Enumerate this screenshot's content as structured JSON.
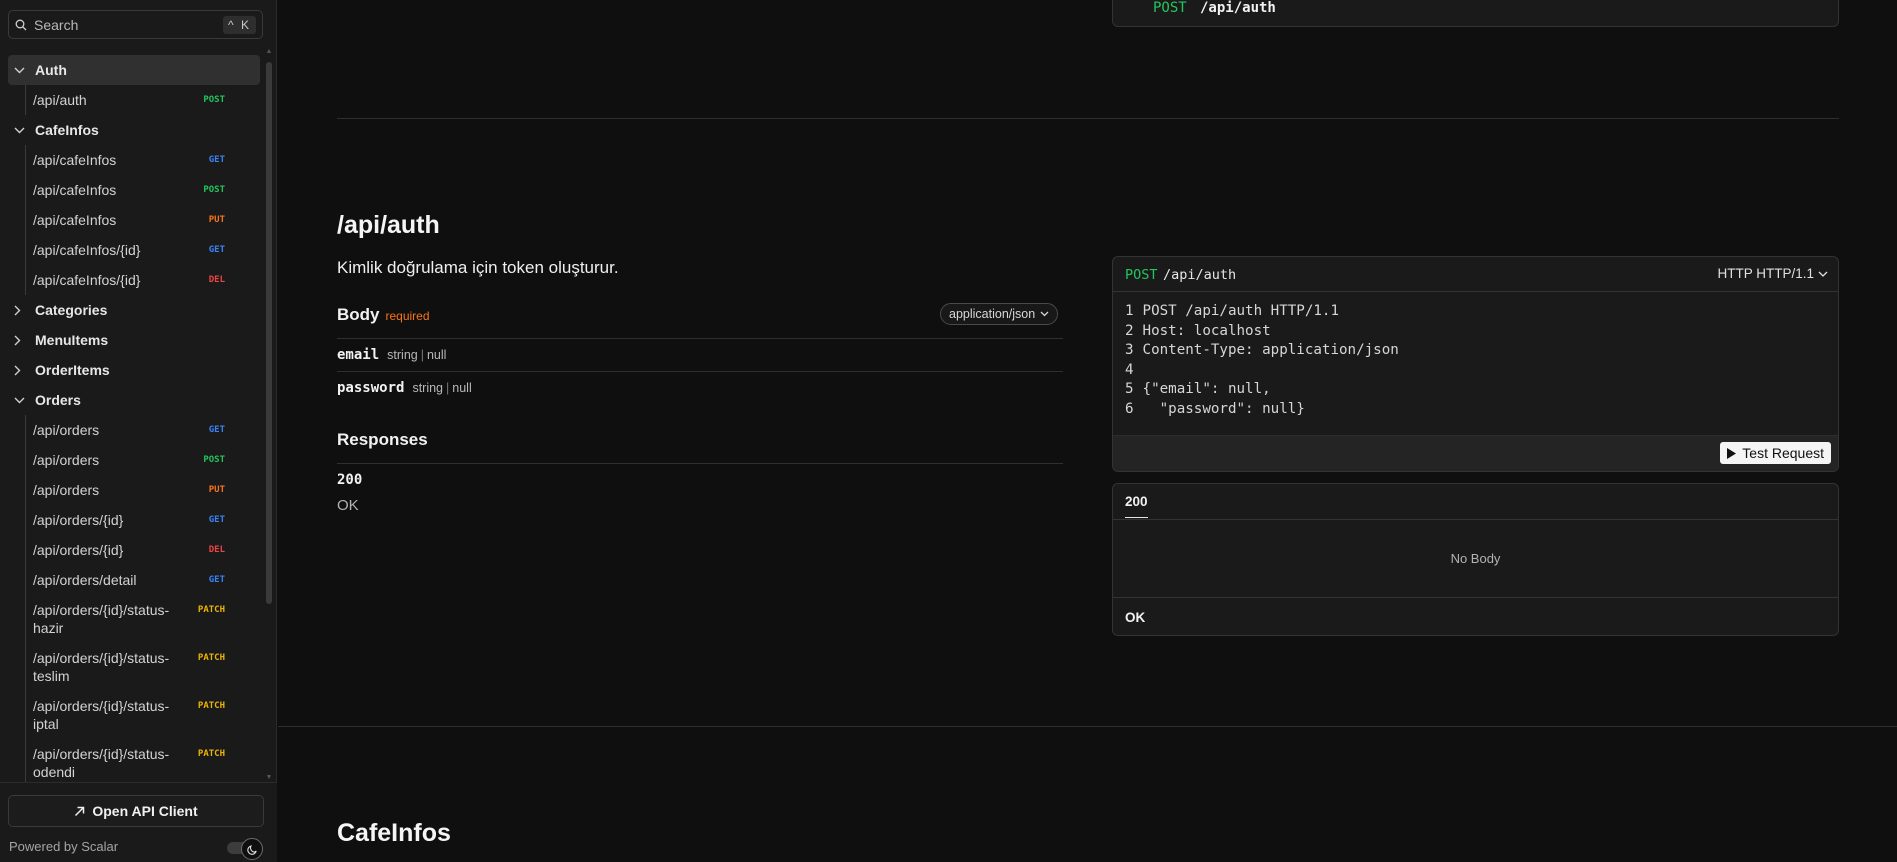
{
  "search": {
    "placeholder": "Search",
    "shortcut": "^ K"
  },
  "sidebar": {
    "groups": [
      {
        "label": "Auth",
        "expanded": true,
        "active": true,
        "items": [
          {
            "path": "/api/auth",
            "method": "POST"
          }
        ]
      },
      {
        "label": "CafeInfos",
        "expanded": true,
        "items": [
          {
            "path": "/api/cafeInfos",
            "method": "GET"
          },
          {
            "path": "/api/cafeInfos",
            "method": "POST"
          },
          {
            "path": "/api/cafeInfos",
            "method": "PUT"
          },
          {
            "path": "/api/cafeInfos/{id}",
            "method": "GET"
          },
          {
            "path": "/api/cafeInfos/{id}",
            "method": "DEL"
          }
        ]
      },
      {
        "label": "Categories",
        "expanded": false,
        "items": []
      },
      {
        "label": "MenuItems",
        "expanded": false,
        "items": []
      },
      {
        "label": "OrderItems",
        "expanded": false,
        "items": []
      },
      {
        "label": "Orders",
        "expanded": true,
        "items": [
          {
            "path": "/api/orders",
            "method": "GET"
          },
          {
            "path": "/api/orders",
            "method": "POST"
          },
          {
            "path": "/api/orders",
            "method": "PUT"
          },
          {
            "path": "/api/orders/{id}",
            "method": "GET"
          },
          {
            "path": "/api/orders/{id}",
            "method": "DEL"
          },
          {
            "path": "/api/orders/detail",
            "method": "GET"
          },
          {
            "path": "/api/orders/{id}/status-hazir",
            "method": "PATCH"
          },
          {
            "path": "/api/orders/{id}/status-teslim",
            "method": "PATCH"
          },
          {
            "path": "/api/orders/{id}/status-iptal",
            "method": "PATCH"
          },
          {
            "path": "/api/orders/{id}/status-odendi",
            "method": "PATCH"
          }
        ]
      }
    ],
    "open_client": "Open API Client",
    "powered_by": "Powered by Scalar"
  },
  "top_card": {
    "method": "POST",
    "path": "/api/auth"
  },
  "endpoint": {
    "title": "/api/auth",
    "description": "Kimlik doğrulama için token oluşturur.",
    "body_label": "Body",
    "required_label": "required",
    "content_type": "application/json",
    "fields": [
      {
        "name": "email",
        "type": "string",
        "nullable": "null"
      },
      {
        "name": "password",
        "type": "string",
        "nullable": "null"
      }
    ],
    "responses_label": "Responses",
    "responses": [
      {
        "code": "200",
        "text": "OK"
      }
    ]
  },
  "request_card": {
    "method": "POST",
    "path": "/api/auth",
    "protocol": "HTTP HTTP/1.1",
    "lines": [
      {
        "n": "1",
        "text": "POST /api/auth HTTP/1.1"
      },
      {
        "n": "2",
        "text": "Host: localhost"
      },
      {
        "n": "3",
        "text": "Content-Type: application/json"
      },
      {
        "n": "4",
        "text": ""
      },
      {
        "n": "5",
        "text": "{\"email\": null,"
      },
      {
        "n": "6",
        "text": "  \"password\": null}"
      }
    ],
    "test_button": "Test Request"
  },
  "response_card": {
    "tab": "200",
    "empty": "No Body",
    "status": "OK"
  },
  "next_section": {
    "title": "CafeInfos"
  },
  "colors": {
    "get": "#3b82f6",
    "post": "#22c55e",
    "put": "#f97316",
    "del": "#ef4444",
    "patch": "#eab308"
  }
}
